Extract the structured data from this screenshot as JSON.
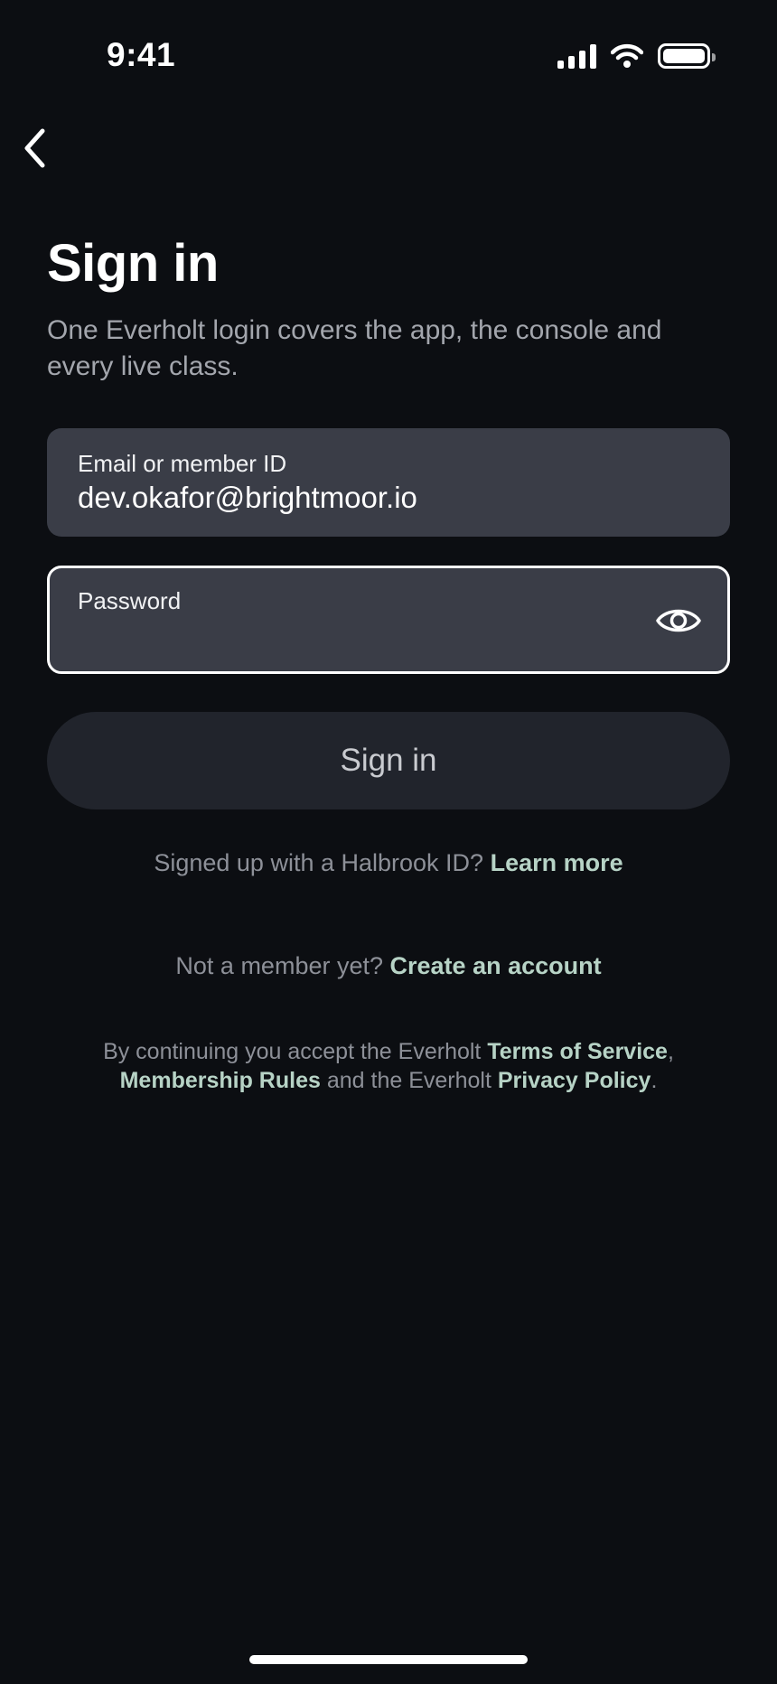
{
  "status_bar": {
    "time": "9:41",
    "icons": [
      "cellular-signal-icon",
      "wifi-icon",
      "battery-icon"
    ]
  },
  "nav": {
    "back_icon": "chevron-left-icon"
  },
  "header": {
    "title": "Sign in",
    "subtitle": "One Everholt login covers the app, the console and every live class."
  },
  "form": {
    "email": {
      "label": "Email or member ID",
      "value": "dev.okafor@brightmoor.io"
    },
    "password": {
      "label": "Password",
      "value": "",
      "toggle_icon": "eye-icon"
    },
    "submit_label": "Sign in"
  },
  "halbrook": {
    "text": "Signed up with a Halbrook ID?",
    "link": "Learn more"
  },
  "signup": {
    "text": "Not a member yet?",
    "link": "Create an account"
  },
  "legal": {
    "prefix": "By continuing you accept the Everholt",
    "terms_link": "Terms of Service",
    "comma": ",",
    "rules_link": "Membership Rules",
    "middle": "and the Everholt",
    "privacy_link": "Privacy Policy",
    "suffix": "."
  },
  "colors": {
    "background": "#0c0e12",
    "field_bg": "#3a3d47",
    "button_bg": "#21242c",
    "link": "#b7d3c6",
    "muted_text": "#8d9098"
  }
}
